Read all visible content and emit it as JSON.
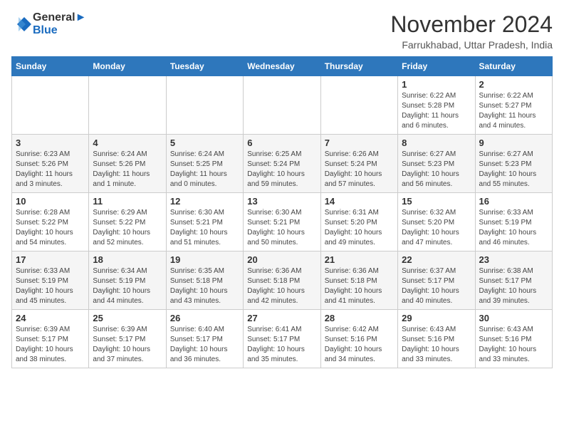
{
  "header": {
    "logo_line1": "General",
    "logo_line2": "Blue",
    "title": "November 2024",
    "subtitle": "Farrukhabad, Uttar Pradesh, India"
  },
  "columns": [
    "Sunday",
    "Monday",
    "Tuesday",
    "Wednesday",
    "Thursday",
    "Friday",
    "Saturday"
  ],
  "weeks": [
    [
      {
        "day": "",
        "info": ""
      },
      {
        "day": "",
        "info": ""
      },
      {
        "day": "",
        "info": ""
      },
      {
        "day": "",
        "info": ""
      },
      {
        "day": "",
        "info": ""
      },
      {
        "day": "1",
        "info": "Sunrise: 6:22 AM\nSunset: 5:28 PM\nDaylight: 11 hours and 6 minutes."
      },
      {
        "day": "2",
        "info": "Sunrise: 6:22 AM\nSunset: 5:27 PM\nDaylight: 11 hours and 4 minutes."
      }
    ],
    [
      {
        "day": "3",
        "info": "Sunrise: 6:23 AM\nSunset: 5:26 PM\nDaylight: 11 hours and 3 minutes."
      },
      {
        "day": "4",
        "info": "Sunrise: 6:24 AM\nSunset: 5:26 PM\nDaylight: 11 hours and 1 minute."
      },
      {
        "day": "5",
        "info": "Sunrise: 6:24 AM\nSunset: 5:25 PM\nDaylight: 11 hours and 0 minutes."
      },
      {
        "day": "6",
        "info": "Sunrise: 6:25 AM\nSunset: 5:24 PM\nDaylight: 10 hours and 59 minutes."
      },
      {
        "day": "7",
        "info": "Sunrise: 6:26 AM\nSunset: 5:24 PM\nDaylight: 10 hours and 57 minutes."
      },
      {
        "day": "8",
        "info": "Sunrise: 6:27 AM\nSunset: 5:23 PM\nDaylight: 10 hours and 56 minutes."
      },
      {
        "day": "9",
        "info": "Sunrise: 6:27 AM\nSunset: 5:23 PM\nDaylight: 10 hours and 55 minutes."
      }
    ],
    [
      {
        "day": "10",
        "info": "Sunrise: 6:28 AM\nSunset: 5:22 PM\nDaylight: 10 hours and 54 minutes."
      },
      {
        "day": "11",
        "info": "Sunrise: 6:29 AM\nSunset: 5:22 PM\nDaylight: 10 hours and 52 minutes."
      },
      {
        "day": "12",
        "info": "Sunrise: 6:30 AM\nSunset: 5:21 PM\nDaylight: 10 hours and 51 minutes."
      },
      {
        "day": "13",
        "info": "Sunrise: 6:30 AM\nSunset: 5:21 PM\nDaylight: 10 hours and 50 minutes."
      },
      {
        "day": "14",
        "info": "Sunrise: 6:31 AM\nSunset: 5:20 PM\nDaylight: 10 hours and 49 minutes."
      },
      {
        "day": "15",
        "info": "Sunrise: 6:32 AM\nSunset: 5:20 PM\nDaylight: 10 hours and 47 minutes."
      },
      {
        "day": "16",
        "info": "Sunrise: 6:33 AM\nSunset: 5:19 PM\nDaylight: 10 hours and 46 minutes."
      }
    ],
    [
      {
        "day": "17",
        "info": "Sunrise: 6:33 AM\nSunset: 5:19 PM\nDaylight: 10 hours and 45 minutes."
      },
      {
        "day": "18",
        "info": "Sunrise: 6:34 AM\nSunset: 5:19 PM\nDaylight: 10 hours and 44 minutes."
      },
      {
        "day": "19",
        "info": "Sunrise: 6:35 AM\nSunset: 5:18 PM\nDaylight: 10 hours and 43 minutes."
      },
      {
        "day": "20",
        "info": "Sunrise: 6:36 AM\nSunset: 5:18 PM\nDaylight: 10 hours and 42 minutes."
      },
      {
        "day": "21",
        "info": "Sunrise: 6:36 AM\nSunset: 5:18 PM\nDaylight: 10 hours and 41 minutes."
      },
      {
        "day": "22",
        "info": "Sunrise: 6:37 AM\nSunset: 5:17 PM\nDaylight: 10 hours and 40 minutes."
      },
      {
        "day": "23",
        "info": "Sunrise: 6:38 AM\nSunset: 5:17 PM\nDaylight: 10 hours and 39 minutes."
      }
    ],
    [
      {
        "day": "24",
        "info": "Sunrise: 6:39 AM\nSunset: 5:17 PM\nDaylight: 10 hours and 38 minutes."
      },
      {
        "day": "25",
        "info": "Sunrise: 6:39 AM\nSunset: 5:17 PM\nDaylight: 10 hours and 37 minutes."
      },
      {
        "day": "26",
        "info": "Sunrise: 6:40 AM\nSunset: 5:17 PM\nDaylight: 10 hours and 36 minutes."
      },
      {
        "day": "27",
        "info": "Sunrise: 6:41 AM\nSunset: 5:17 PM\nDaylight: 10 hours and 35 minutes."
      },
      {
        "day": "28",
        "info": "Sunrise: 6:42 AM\nSunset: 5:16 PM\nDaylight: 10 hours and 34 minutes."
      },
      {
        "day": "29",
        "info": "Sunrise: 6:43 AM\nSunset: 5:16 PM\nDaylight: 10 hours and 33 minutes."
      },
      {
        "day": "30",
        "info": "Sunrise: 6:43 AM\nSunset: 5:16 PM\nDaylight: 10 hours and 33 minutes."
      }
    ]
  ]
}
